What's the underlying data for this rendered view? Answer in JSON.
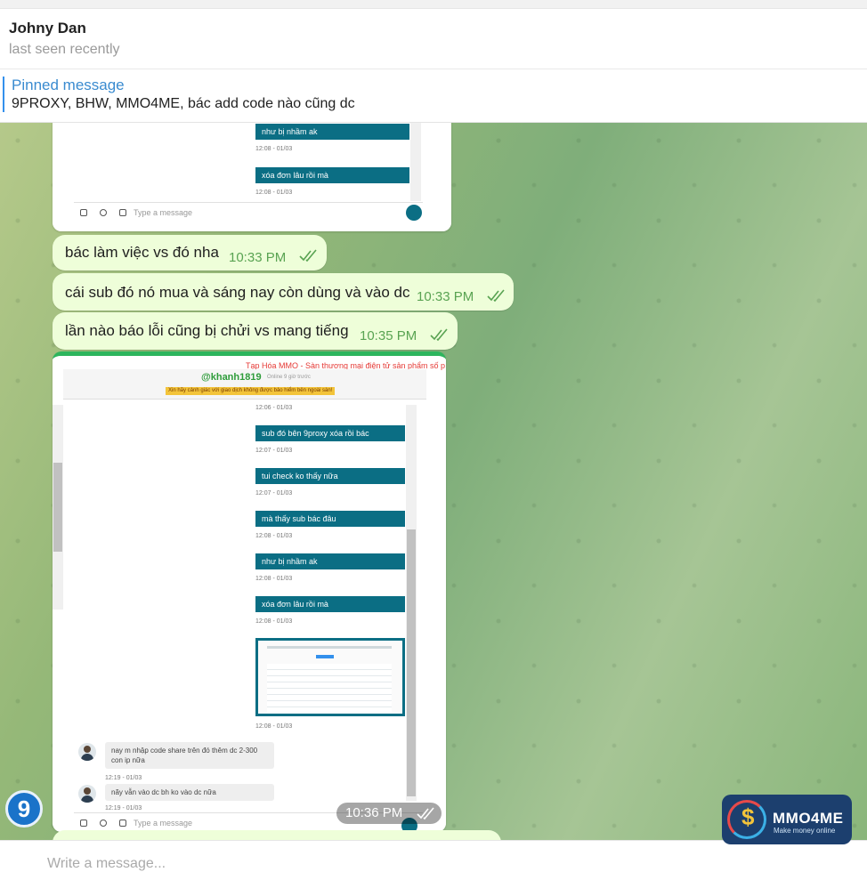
{
  "header": {
    "name": "Johny Dan",
    "status": "last seen recently"
  },
  "pinned": {
    "title": "Pinned message",
    "text": "9PROXY, BHW, MMO4ME, bác add code nào cũng dc"
  },
  "top_screenshot": {
    "messages": [
      {
        "text": "như bị nhầm ak",
        "stamp": "12:08 - 01/03"
      },
      {
        "text": "xóa đơn lâu rồi mà",
        "stamp": "12:08 - 01/03"
      }
    ],
    "composer_placeholder": "Type a message"
  },
  "messages": [
    {
      "text": "bác làm việc vs đó nha",
      "time": "10:33 PM"
    },
    {
      "text": "cái sub đó nó mua và sáng nay còn dùng và vào dc",
      "time": "10:33 PM"
    },
    {
      "text": "lần nào báo lỗi cũng bị chửi vs mang tiếng",
      "time": "10:35 PM"
    }
  ],
  "big_screenshot": {
    "site_banner": "Tạp Hóa MMO - Sàn thương mại điện tử sản phẩm số p",
    "username": "@khanh1819",
    "online": "Online 9 giờ trước",
    "warning": "Xin hãy cảnh giác với giao dịch không được bảo hiểm bên ngoài sàn!",
    "first_stamp": "12:06 - 01/03",
    "messages": [
      {
        "text": "sub đó bên 9proxy xóa rồi bác",
        "stamp": "12:07 - 01/03"
      },
      {
        "text": "tui check ko thấy nữa",
        "stamp": "12:07 - 01/03"
      },
      {
        "text": "mà thấy sub bác đâu",
        "stamp": "12:08 - 01/03"
      },
      {
        "text": "như bị nhầm ak",
        "stamp": "12:08 - 01/03"
      },
      {
        "text": "xóa đơn lâu rồi mà",
        "stamp": "12:08 - 01/03"
      }
    ],
    "image_stamp": "12:08 - 01/03",
    "replies": [
      {
        "text": "nay m nhập code share trên đó thêm dc 2-300 con ip nữa",
        "stamp": "12:19 - 01/03"
      },
      {
        "text": "nãy vẫn vào dc bh ko vào dc nữa",
        "stamp": "12:19 - 01/03"
      }
    ],
    "composer_placeholder": "Type a message"
  },
  "image_time": "10:36 PM",
  "composer": {
    "placeholder": "Write a message..."
  },
  "badge": {
    "label": "9"
  },
  "logo": {
    "brand": "MMO4ME",
    "tagline": "Make money online",
    "symbol": "$"
  },
  "colors": {
    "bubble": "#eefed9",
    "time": "#59a352",
    "accent": "#3390ec",
    "ss_message": "#0b6e84"
  }
}
